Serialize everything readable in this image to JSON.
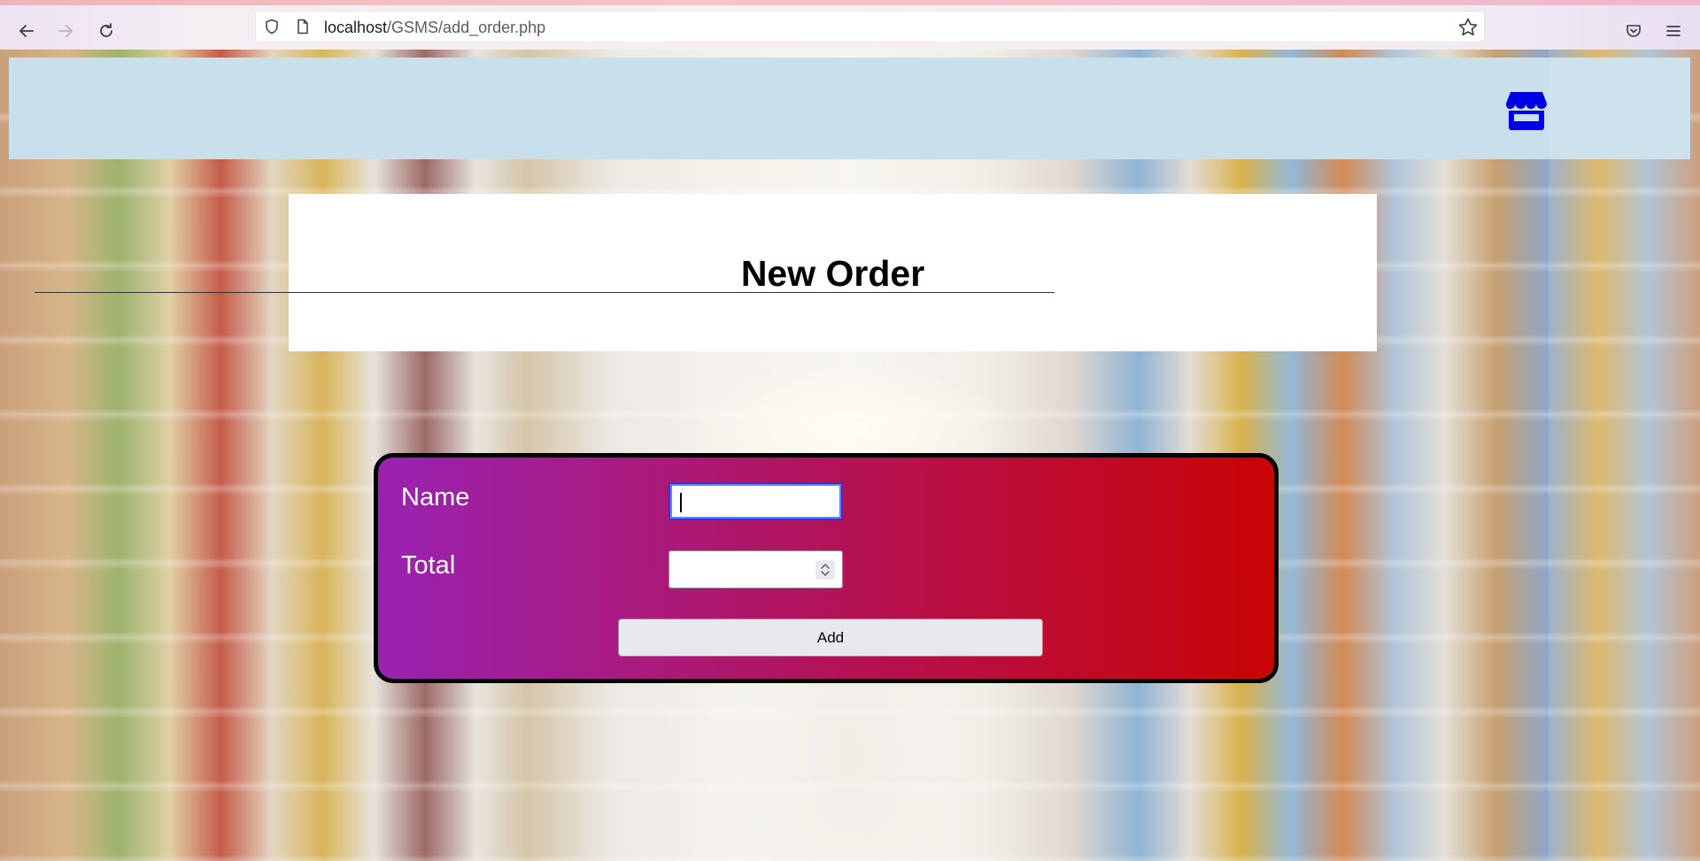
{
  "browser": {
    "url_host": "localhost",
    "url_path": "/GSMS/add_order.php"
  },
  "header": {
    "logo_icon": "store-icon",
    "accent_color": "#0000e6"
  },
  "title_card": {
    "title": "New Order"
  },
  "form": {
    "name_label": "Name",
    "name_value": "",
    "total_label": "Total",
    "total_value": "",
    "submit_label": "Add",
    "gradient_colors": [
      "#9a22b2",
      "#c80404"
    ]
  }
}
